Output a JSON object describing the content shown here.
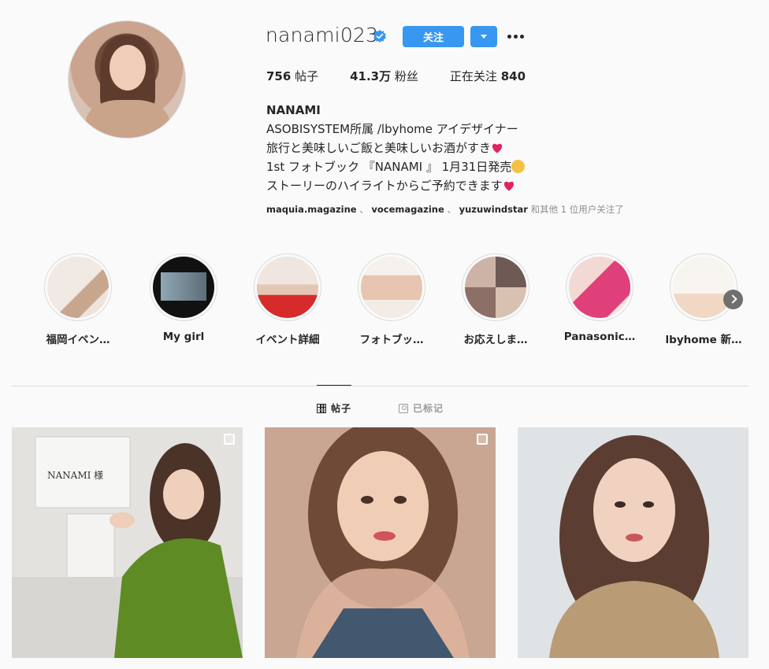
{
  "profile": {
    "username": "nanami023",
    "follow_label": "关注",
    "stats": {
      "posts_value": "756",
      "posts_label": "帖子",
      "followers_value": "41.3万",
      "followers_label": "粉丝",
      "following_label": "正在关注",
      "following_value": "840"
    },
    "bio": {
      "name": "NANAMI",
      "line1": "ASOBISYSTEM所属 /lbyhome アイデザイナー",
      "line2": "旅行と美味しいご飯と美味しいお酒がすき",
      "line3": "1st フォトブック 『NANAMI 』 1月31日発売",
      "line4": "ストーリーのハイライトからご予約できます"
    },
    "followed_by": {
      "user1": "maquia.magazine",
      "sep1": "、",
      "user2": "vocemagazine",
      "sep2": "、",
      "user3": "yuzuwindstar",
      "suffix": "和其他 1 位用户关注了"
    }
  },
  "highlights": [
    {
      "label": "福岡イベン…"
    },
    {
      "label": "My girl"
    },
    {
      "label": "イベント詳細"
    },
    {
      "label": "フォトブッ…"
    },
    {
      "label": "お応えしま…"
    },
    {
      "label": "Panasonic…"
    },
    {
      "label": "lbyhome 新…"
    }
  ],
  "tabs": {
    "posts": "帖子",
    "tagged": "已标记"
  },
  "colors": {
    "accent": "#3897f0",
    "text": "#262626",
    "muted": "#8e8e8e",
    "border": "#dbdbdb",
    "background": "#fafafa"
  },
  "icons": [
    "verified-badge-icon",
    "chevron-down-icon",
    "more-options-icon",
    "heart-emoji-icon",
    "smiley-emoji-icon",
    "chevron-right-icon",
    "grid-icon",
    "tag-icon",
    "multiple-photos-icon"
  ]
}
